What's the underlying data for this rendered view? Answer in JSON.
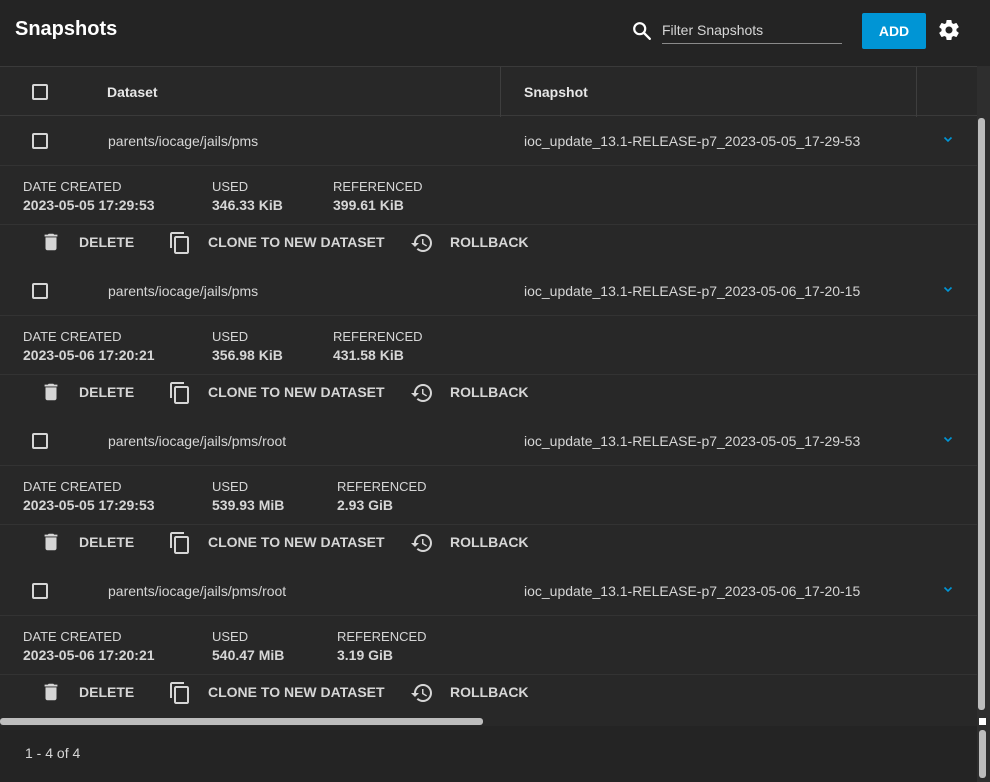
{
  "page": {
    "title": "Snapshots"
  },
  "search": {
    "placeholder": "Filter Snapshots",
    "value": ""
  },
  "toolbar": {
    "add_label": "ADD"
  },
  "table": {
    "columns": [
      "Dataset",
      "Snapshot"
    ],
    "detail_labels": {
      "date_created": "DATE CREATED",
      "used": "USED",
      "referenced": "REFERENCED"
    },
    "actions": {
      "delete": "DELETE",
      "clone": "CLONE TO NEW DATASET",
      "rollback": "ROLLBACK"
    },
    "rows": [
      {
        "dataset": "parents/iocage/jails/pms",
        "snapshot": "ioc_update_13.1-RELEASE-p7_2023-05-05_17-29-53",
        "date_created": "2023-05-05 17:29:53",
        "used": "346.33 KiB",
        "referenced": "399.61 KiB"
      },
      {
        "dataset": "parents/iocage/jails/pms",
        "snapshot": "ioc_update_13.1-RELEASE-p7_2023-05-06_17-20-15",
        "date_created": "2023-05-06 17:20:21",
        "used": "356.98 KiB",
        "referenced": "431.58 KiB"
      },
      {
        "dataset": "parents/iocage/jails/pms/root",
        "snapshot": "ioc_update_13.1-RELEASE-p7_2023-05-05_17-29-53",
        "date_created": "2023-05-05 17:29:53",
        "used": "539.93 MiB",
        "referenced": "2.93 GiB"
      },
      {
        "dataset": "parents/iocage/jails/pms/root",
        "snapshot": "ioc_update_13.1-RELEASE-p7_2023-05-06_17-20-15",
        "date_created": "2023-05-06 17:20:21",
        "used": "540.47 MiB",
        "referenced": "3.19 GiB"
      }
    ]
  },
  "paginator": {
    "range_label": "1 - 4 of 4"
  },
  "colors": {
    "accent": "#0095d5",
    "background": "#282828",
    "header": "#242424",
    "text": "#d6d6d6"
  },
  "icons": [
    "search-icon",
    "gear-icon",
    "checkbox",
    "chevron-down-icon",
    "trash-icon",
    "clone-icon",
    "history-icon"
  ]
}
